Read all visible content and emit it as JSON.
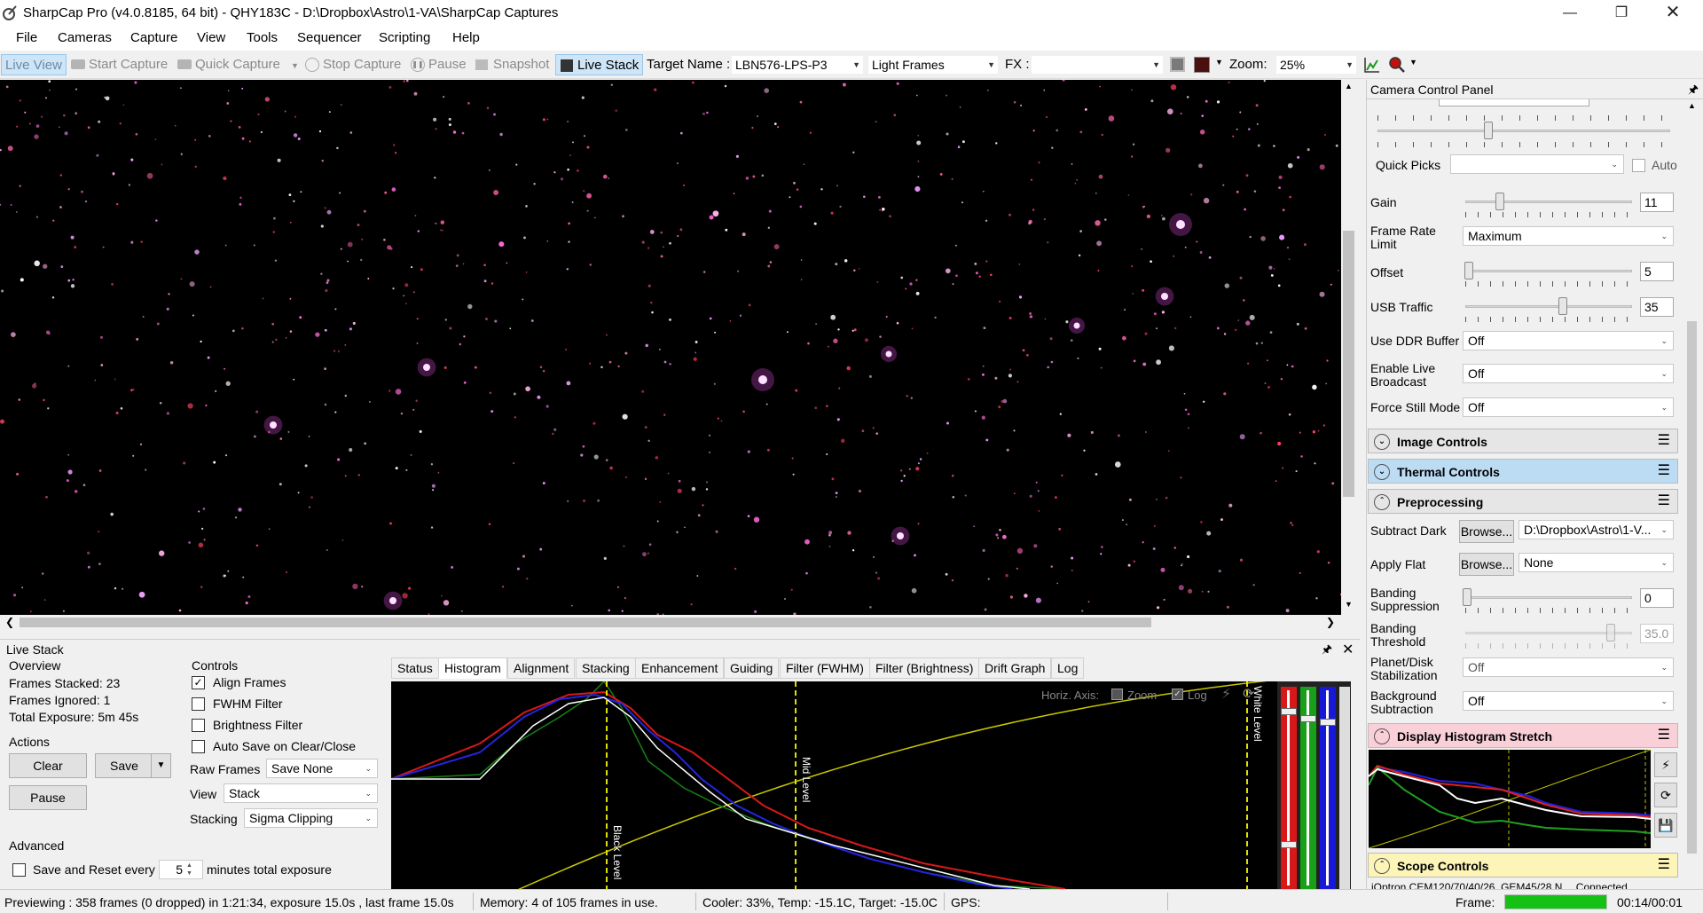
{
  "window": {
    "title": "SharpCap Pro (v4.0.8185, 64 bit) - QHY183C - D:\\Dropbox\\Astro\\1-VA\\SharpCap Captures"
  },
  "menu": [
    "File",
    "Cameras",
    "Capture",
    "View",
    "Tools",
    "Sequencer",
    "Scripting",
    "Help"
  ],
  "toolbar": {
    "live_view": "Live View",
    "start_capture": "Start Capture",
    "quick_capture": "Quick Capture",
    "stop_capture": "Stop Capture",
    "pause": "Pause",
    "snapshot": "Snapshot",
    "live_stack": "Live Stack",
    "target_name_label": "Target Name :",
    "target_name_value": "LBN576-LPS-P3",
    "frame_type": "Light Frames",
    "fx_label": "FX :",
    "fx_value": "",
    "zoom_label": "Zoom:",
    "zoom_value": "25%"
  },
  "camera_panel": {
    "title": "Camera Control Panel",
    "quick_picks_label": "Quick Picks",
    "quick_picks_value": "",
    "auto_label": "Auto",
    "gain_label": "Gain",
    "gain_value": "11",
    "frame_rate_label": "Frame Rate Limit",
    "frame_rate_value": "Maximum",
    "offset_label": "Offset",
    "offset_value": "5",
    "usb_label": "USB Traffic",
    "usb_value": "35",
    "ddr_label": "Use DDR Buffer",
    "ddr_value": "Off",
    "broadcast_label": "Enable Live Broadcast",
    "broadcast_value": "Off",
    "force_still_label": "Force Still Mode",
    "force_still_value": "Off",
    "sections": {
      "image_controls": "Image Controls",
      "thermal_controls": "Thermal Controls",
      "preprocessing": "Preprocessing",
      "display_histogram": "Display Histogram Stretch",
      "scope_controls": "Scope Controls"
    },
    "subtract_dark_label": "Subtract Dark",
    "subtract_dark_browse": "Browse...",
    "subtract_dark_value": "D:\\Dropbox\\Astro\\1-V...",
    "apply_flat_label": "Apply Flat",
    "apply_flat_browse": "Browse...",
    "apply_flat_value": "None",
    "banding_supp_label": "Banding Suppression",
    "banding_supp_value": "0",
    "banding_thresh_label": "Banding Threshold",
    "banding_thresh_value": "35.0",
    "planet_label": "Planet/Disk Stabilization",
    "planet_value": "Off",
    "bg_sub_label": "Background Subtraction",
    "bg_sub_value": "Off",
    "scope_line": "iOptron CEM120/70/40/26, GEM45/28 N",
    "scope_status": "Connected"
  },
  "live_stack": {
    "title": "Live Stack",
    "overview_label": "Overview",
    "frames_stacked": "Frames Stacked: 23",
    "frames_ignored": "Frames Ignored:  1",
    "total_exposure": "Total Exposure:   5m 45s",
    "actions_label": "Actions",
    "clear": "Clear",
    "save": "Save",
    "pause": "Pause",
    "advanced_label": "Advanced",
    "save_reset_label": "Save and Reset every",
    "save_reset_value": "5",
    "save_reset_suffix": "minutes total exposure",
    "controls_label": "Controls",
    "align_frames": "Align Frames",
    "fwhm_filter": "FWHM Filter",
    "brightness_filter": "Brightness Filter",
    "auto_save": "Auto Save on Clear/Close",
    "raw_frames_label": "Raw Frames",
    "raw_frames_value": "Save None",
    "view_label": "View",
    "view_value": "Stack",
    "stacking_label": "Stacking",
    "stacking_value": "Sigma Clipping",
    "tabs": [
      "Status",
      "Histogram",
      "Alignment",
      "Stacking",
      "Enhancement",
      "Guiding",
      "Filter (FWHM)",
      "Filter (Brightness)",
      "Drift Graph",
      "Log"
    ],
    "hist": {
      "horiz_axis": "Horiz. Axis:",
      "zoom": "Zoom",
      "log": "Log",
      "black_level": "Black Level",
      "mid_level": "Mid Level",
      "white_level": "White Level"
    }
  },
  "status": {
    "previewing": "Previewing : 358 frames (0 dropped) in 1:21:34, exposure 15.0s , last frame 15.0s",
    "memory": "Memory: 4 of 105 frames in use.",
    "cooler": "Cooler: 33%, Temp: -15.1C, Target: -15.0C",
    "gps": "GPS:",
    "frame_label": "Frame:",
    "frame_time": "00:14/00:01"
  },
  "colors": {
    "selection": "#cde5f7",
    "thermal_header": "#bcdcf4",
    "histogram_header": "#f9cfd8",
    "scope_header": "#fdf4b8",
    "frame_progress": "#16c116"
  }
}
